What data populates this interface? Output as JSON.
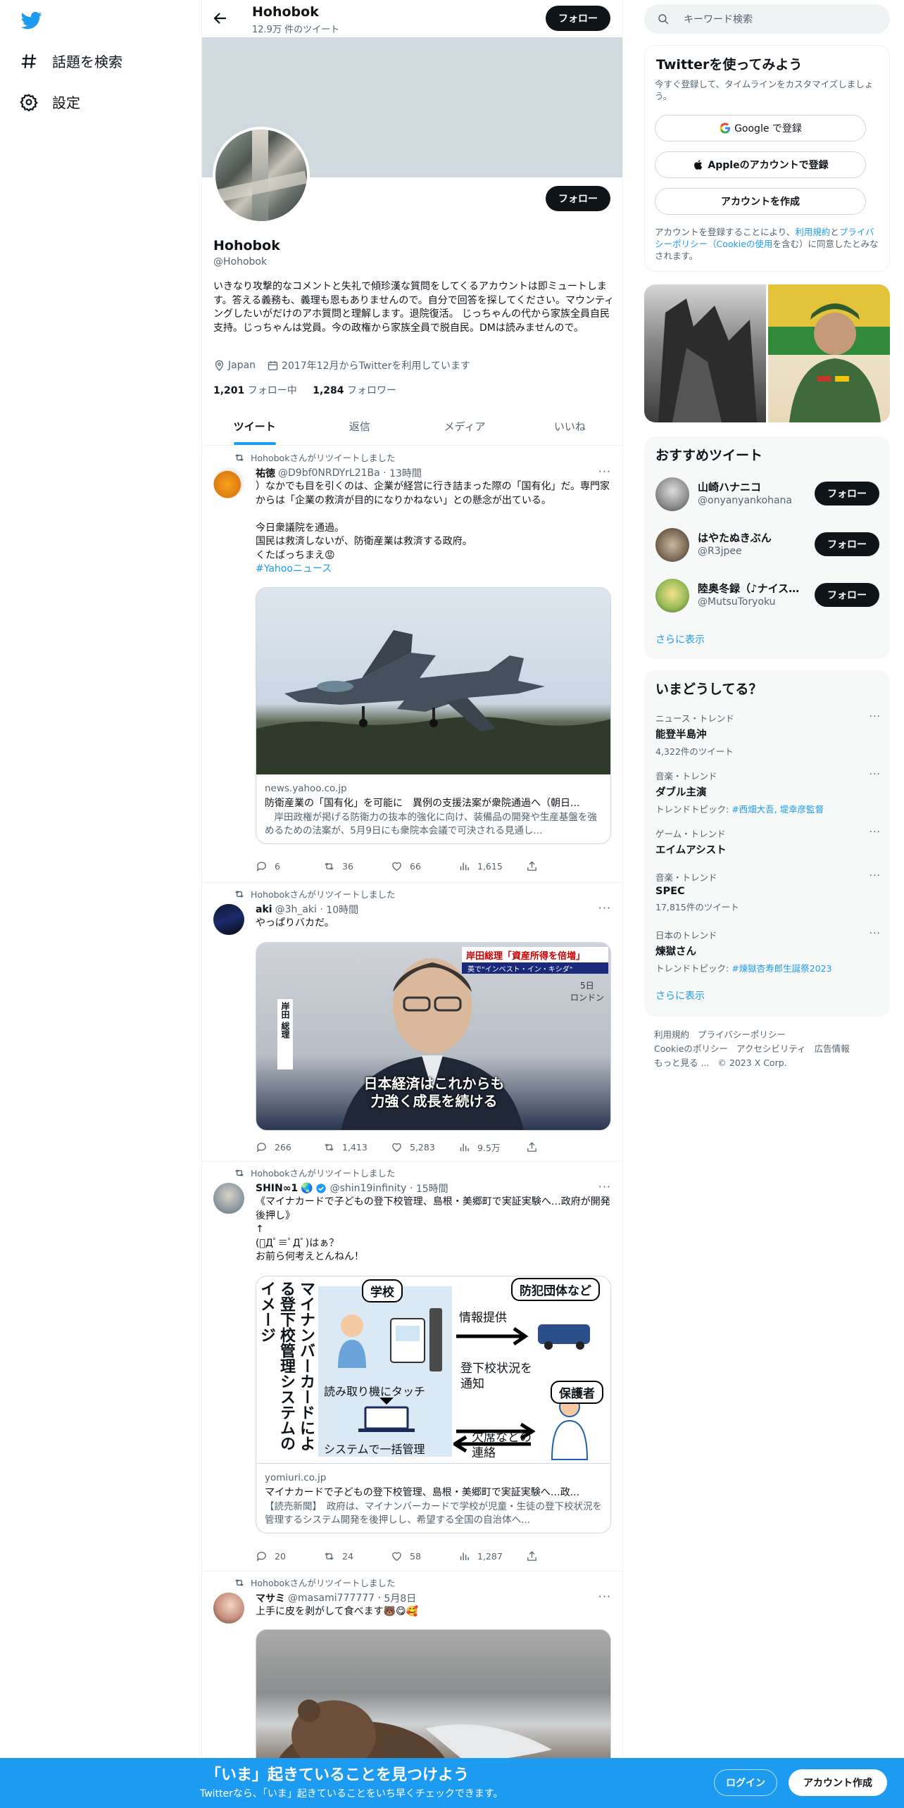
{
  "leftnav": {
    "items": [
      {
        "label": "話題を検索",
        "icon": "hashtag-icon"
      },
      {
        "label": "設定",
        "icon": "gear-icon"
      }
    ]
  },
  "topbar": {
    "name": "Hohobok",
    "tweet_count": "12.9万 件のツイート",
    "follow_label": "フォロー"
  },
  "profile": {
    "name": "Hohobok",
    "handle": "@Hohobok",
    "follow_label": "フォロー",
    "bio": "いきなり攻撃的なコメントと失礼で傾珍漢な質問をしてくるアカウントは即ミュートします。答える義務も、義理も恩もありませんので。自分で回答を探してください。マウンティングしたいがだけのアホ質問と理解します。退院復活。 じっちゃんの代から家族全員自民支持。じっちゃんは党員。今の政権から家族全員で脱自民。DMは読みませんので。",
    "location": "Japan",
    "joined": "2017年12月からTwitterを利用しています",
    "following_count": "1,201",
    "following_label": "フォロー中",
    "followers_count": "1,284",
    "followers_label": "フォロワー"
  },
  "tabs": [
    {
      "label": "ツイート"
    },
    {
      "label": "返信"
    },
    {
      "label": "メディア"
    },
    {
      "label": "いいね"
    }
  ],
  "tweets": [
    {
      "retweet_label": "Hohobokさんがリツイートしました",
      "name": "祐徳",
      "handle": "@D9bf0NRDYrL21Ba",
      "time": "13時間",
      "text": "）なかでも目を引くのは、企業が経営に行き詰まった際の「国有化」だ。専門家からは「企業の救済が目的になりかねない」との懸念が出ている。\n\n今日衆議院を通過。\n国民は救済しないが、防衛産業は救済する政府。\nくたばっちまえ😡",
      "hashtag": "#Yahooニュース",
      "card_domain": "news.yahoo.co.jp",
      "card_title": "防衛産業の「国有化」を可能に　異例の支援法案が衆院通過へ（朝日...",
      "card_desc": "　岸田政権が掲げる防衛力の抜本的強化に向け、装備品の開発や生産基盤を強めるための法案が、5月9日にも衆院本会議で可決される見通し...",
      "replies": "6",
      "retweets": "36",
      "likes": "66",
      "views": "1,615"
    },
    {
      "retweet_label": "Hohobokさんがリツイートしました",
      "name": "aki",
      "handle": "@3h_aki",
      "time": "10時間",
      "text": "やっぱりバカだ。",
      "media_caption_top": "岸田総理「資産所得を倍増」",
      "media_caption_sub": "英で\"インベスト・イン・キシダ\"",
      "media_side_label": "岸田 総理",
      "media_place": "5日\nロンドン",
      "media_subtitle": "日本経済はこれからも\n力強く成長を続ける",
      "replies": "266",
      "retweets": "1,413",
      "likes": "5,283",
      "views": "9.5万"
    },
    {
      "retweet_label": "Hohobokさんがリツイートしました",
      "name": "SHIN∞1",
      "handle": "@shin19infinity",
      "time": "15時間",
      "text": "《マイナカードで子どもの登下校管理、島根・美郷町で実証実験へ…政府が開発後押し》\n↑\n(ﾟДﾟ≡ﾟДﾟ)はぁ？\nお前ら何考えとんねん！",
      "card_domain": "yomiuri.co.jp",
      "card_title": "マイナカードで子どもの登下校管理、島根・美郷町で実証実験へ…政...",
      "card_desc": "【読売新聞】　政府は、マイナンバーカードで学校が児童・生徒の登下校状況を管理するシステム開発を後押しし、希望する全国の自治体へ...",
      "diagram": {
        "vertical_title": "マイナンバーカードによる登下校管理システムのイメージ",
        "school": "学校",
        "crime": "防犯団体など",
        "info": "情報提供",
        "touch": "読み取り機にタッチ",
        "notify": "登下校状況を\n通知",
        "guardian": "保護者",
        "system": "システムで一括管理",
        "absence": "欠席などの\n連絡"
      },
      "replies": "20",
      "retweets": "24",
      "likes": "58",
      "views": "1,287"
    },
    {
      "retweet_label": "Hohobokさんがリツイートしました",
      "name": "マサミ",
      "handle": "@masami777777",
      "time": "5月8日",
      "text": "上手に皮を剥がして食べます🐻😋🥰"
    }
  ],
  "search": {
    "placeholder": "キーワード検索"
  },
  "signup": {
    "title": "Twitterを使ってみよう",
    "subtitle": "今すぐ登録して、タイムラインをカスタマイズしましょう。",
    "google": "Google で登録",
    "apple": "Appleのアカウントで登録",
    "create": "アカウントを作成",
    "terms_prefix": "アカウントを登録することにより、",
    "terms_link": "利用規約",
    "terms_mid": "と",
    "privacy_link": "プライバシーポリシー（Cookieの使用",
    "terms_suffix": "を含む）に同意したとみなされます。"
  },
  "recommended": {
    "title": "おすすめツイート",
    "follow_label": "フォロー",
    "more": "さらに表示",
    "users": [
      {
        "name": "山崎ハナニコ",
        "handle": "@onyanyankohana"
      },
      {
        "name": "はやたぬきぶん",
        "handle": "@R3jpee"
      },
      {
        "name": "陸奥冬録（♪ナイスバディ",
        "handle": "@MutsuToryoku"
      }
    ]
  },
  "trends": {
    "title": "いまどうしてる？",
    "more": "さらに表示",
    "items": [
      {
        "category": "ニュース・トレンド",
        "name": "能登半島沖",
        "sub": "4,322件のツイート"
      },
      {
        "category": "音楽・トレンド",
        "name": "ダブル主演",
        "sub_prefix": "トレンドトピック: ",
        "sub_link": "#西畑大吾, 堤幸彦監督"
      },
      {
        "category": "ゲーム・トレンド",
        "name": "エイムアシスト"
      },
      {
        "category": "音楽・トレンド",
        "name": "SPEC",
        "sub": "17,815件のツイート"
      },
      {
        "category": "日本のトレンド",
        "name": "煉獄さん",
        "sub_prefix": "トレンドトピック: ",
        "sub_link": "#煉獄杏寿郎生誕祭2023"
      }
    ]
  },
  "footer": {
    "links": [
      "利用規約",
      "プライバシーポリシー",
      "Cookieのポリシー",
      "アクセシビリティ",
      "広告情報",
      "もっと見る ...",
      "© 2023 X Corp."
    ]
  },
  "bottombar": {
    "title": "「いま」起きていることを見つけよう",
    "subtitle": "Twitterなら、「いま」起きていることをいち早くチェックできます。",
    "login": "ログイン",
    "create": "アカウント作成"
  },
  "colors": {
    "accent": "#1d9bf0",
    "text": "#0f1419",
    "muted": "#536471"
  }
}
